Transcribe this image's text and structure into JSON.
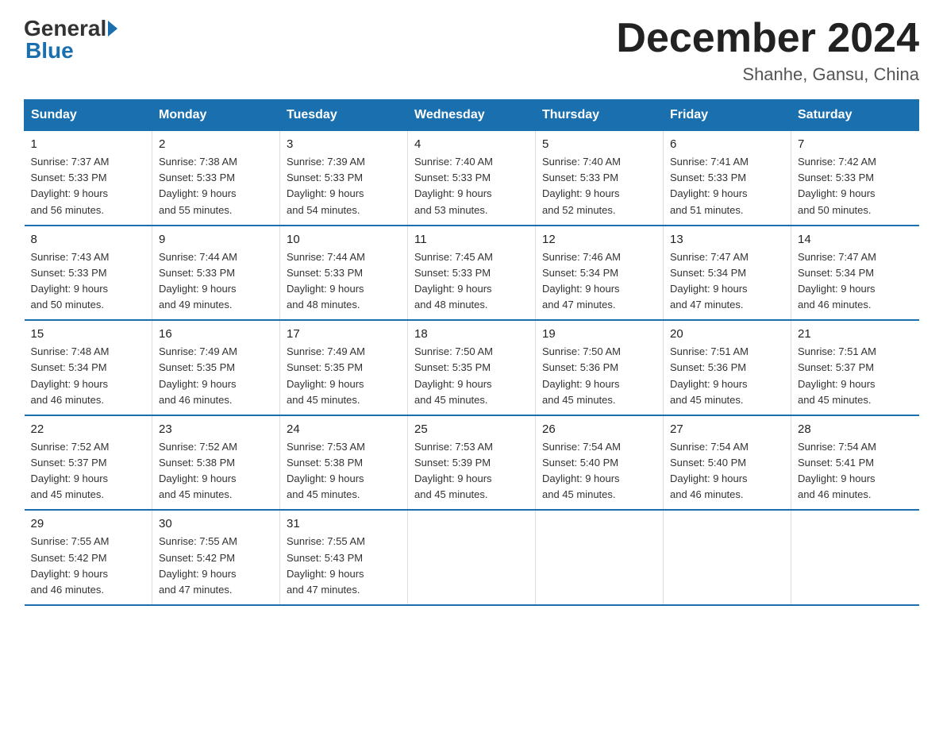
{
  "logo": {
    "general": "General",
    "blue": "Blue"
  },
  "header": {
    "month": "December 2024",
    "location": "Shanhe, Gansu, China"
  },
  "days": [
    "Sunday",
    "Monday",
    "Tuesday",
    "Wednesday",
    "Thursday",
    "Friday",
    "Saturday"
  ],
  "weeks": [
    [
      {
        "day": "1",
        "sunrise": "7:37 AM",
        "sunset": "5:33 PM",
        "daylight": "9 hours and 56 minutes."
      },
      {
        "day": "2",
        "sunrise": "7:38 AM",
        "sunset": "5:33 PM",
        "daylight": "9 hours and 55 minutes."
      },
      {
        "day": "3",
        "sunrise": "7:39 AM",
        "sunset": "5:33 PM",
        "daylight": "9 hours and 54 minutes."
      },
      {
        "day": "4",
        "sunrise": "7:40 AM",
        "sunset": "5:33 PM",
        "daylight": "9 hours and 53 minutes."
      },
      {
        "day": "5",
        "sunrise": "7:40 AM",
        "sunset": "5:33 PM",
        "daylight": "9 hours and 52 minutes."
      },
      {
        "day": "6",
        "sunrise": "7:41 AM",
        "sunset": "5:33 PM",
        "daylight": "9 hours and 51 minutes."
      },
      {
        "day": "7",
        "sunrise": "7:42 AM",
        "sunset": "5:33 PM",
        "daylight": "9 hours and 50 minutes."
      }
    ],
    [
      {
        "day": "8",
        "sunrise": "7:43 AM",
        "sunset": "5:33 PM",
        "daylight": "9 hours and 50 minutes."
      },
      {
        "day": "9",
        "sunrise": "7:44 AM",
        "sunset": "5:33 PM",
        "daylight": "9 hours and 49 minutes."
      },
      {
        "day": "10",
        "sunrise": "7:44 AM",
        "sunset": "5:33 PM",
        "daylight": "9 hours and 48 minutes."
      },
      {
        "day": "11",
        "sunrise": "7:45 AM",
        "sunset": "5:33 PM",
        "daylight": "9 hours and 48 minutes."
      },
      {
        "day": "12",
        "sunrise": "7:46 AM",
        "sunset": "5:34 PM",
        "daylight": "9 hours and 47 minutes."
      },
      {
        "day": "13",
        "sunrise": "7:47 AM",
        "sunset": "5:34 PM",
        "daylight": "9 hours and 47 minutes."
      },
      {
        "day": "14",
        "sunrise": "7:47 AM",
        "sunset": "5:34 PM",
        "daylight": "9 hours and 46 minutes."
      }
    ],
    [
      {
        "day": "15",
        "sunrise": "7:48 AM",
        "sunset": "5:34 PM",
        "daylight": "9 hours and 46 minutes."
      },
      {
        "day": "16",
        "sunrise": "7:49 AM",
        "sunset": "5:35 PM",
        "daylight": "9 hours and 46 minutes."
      },
      {
        "day": "17",
        "sunrise": "7:49 AM",
        "sunset": "5:35 PM",
        "daylight": "9 hours and 45 minutes."
      },
      {
        "day": "18",
        "sunrise": "7:50 AM",
        "sunset": "5:35 PM",
        "daylight": "9 hours and 45 minutes."
      },
      {
        "day": "19",
        "sunrise": "7:50 AM",
        "sunset": "5:36 PM",
        "daylight": "9 hours and 45 minutes."
      },
      {
        "day": "20",
        "sunrise": "7:51 AM",
        "sunset": "5:36 PM",
        "daylight": "9 hours and 45 minutes."
      },
      {
        "day": "21",
        "sunrise": "7:51 AM",
        "sunset": "5:37 PM",
        "daylight": "9 hours and 45 minutes."
      }
    ],
    [
      {
        "day": "22",
        "sunrise": "7:52 AM",
        "sunset": "5:37 PM",
        "daylight": "9 hours and 45 minutes."
      },
      {
        "day": "23",
        "sunrise": "7:52 AM",
        "sunset": "5:38 PM",
        "daylight": "9 hours and 45 minutes."
      },
      {
        "day": "24",
        "sunrise": "7:53 AM",
        "sunset": "5:38 PM",
        "daylight": "9 hours and 45 minutes."
      },
      {
        "day": "25",
        "sunrise": "7:53 AM",
        "sunset": "5:39 PM",
        "daylight": "9 hours and 45 minutes."
      },
      {
        "day": "26",
        "sunrise": "7:54 AM",
        "sunset": "5:40 PM",
        "daylight": "9 hours and 45 minutes."
      },
      {
        "day": "27",
        "sunrise": "7:54 AM",
        "sunset": "5:40 PM",
        "daylight": "9 hours and 46 minutes."
      },
      {
        "day": "28",
        "sunrise": "7:54 AM",
        "sunset": "5:41 PM",
        "daylight": "9 hours and 46 minutes."
      }
    ],
    [
      {
        "day": "29",
        "sunrise": "7:55 AM",
        "sunset": "5:42 PM",
        "daylight": "9 hours and 46 minutes."
      },
      {
        "day": "30",
        "sunrise": "7:55 AM",
        "sunset": "5:42 PM",
        "daylight": "9 hours and 47 minutes."
      },
      {
        "day": "31",
        "sunrise": "7:55 AM",
        "sunset": "5:43 PM",
        "daylight": "9 hours and 47 minutes."
      },
      null,
      null,
      null,
      null
    ]
  ],
  "labels": {
    "sunrise": "Sunrise:",
    "sunset": "Sunset:",
    "daylight": "Daylight:"
  }
}
